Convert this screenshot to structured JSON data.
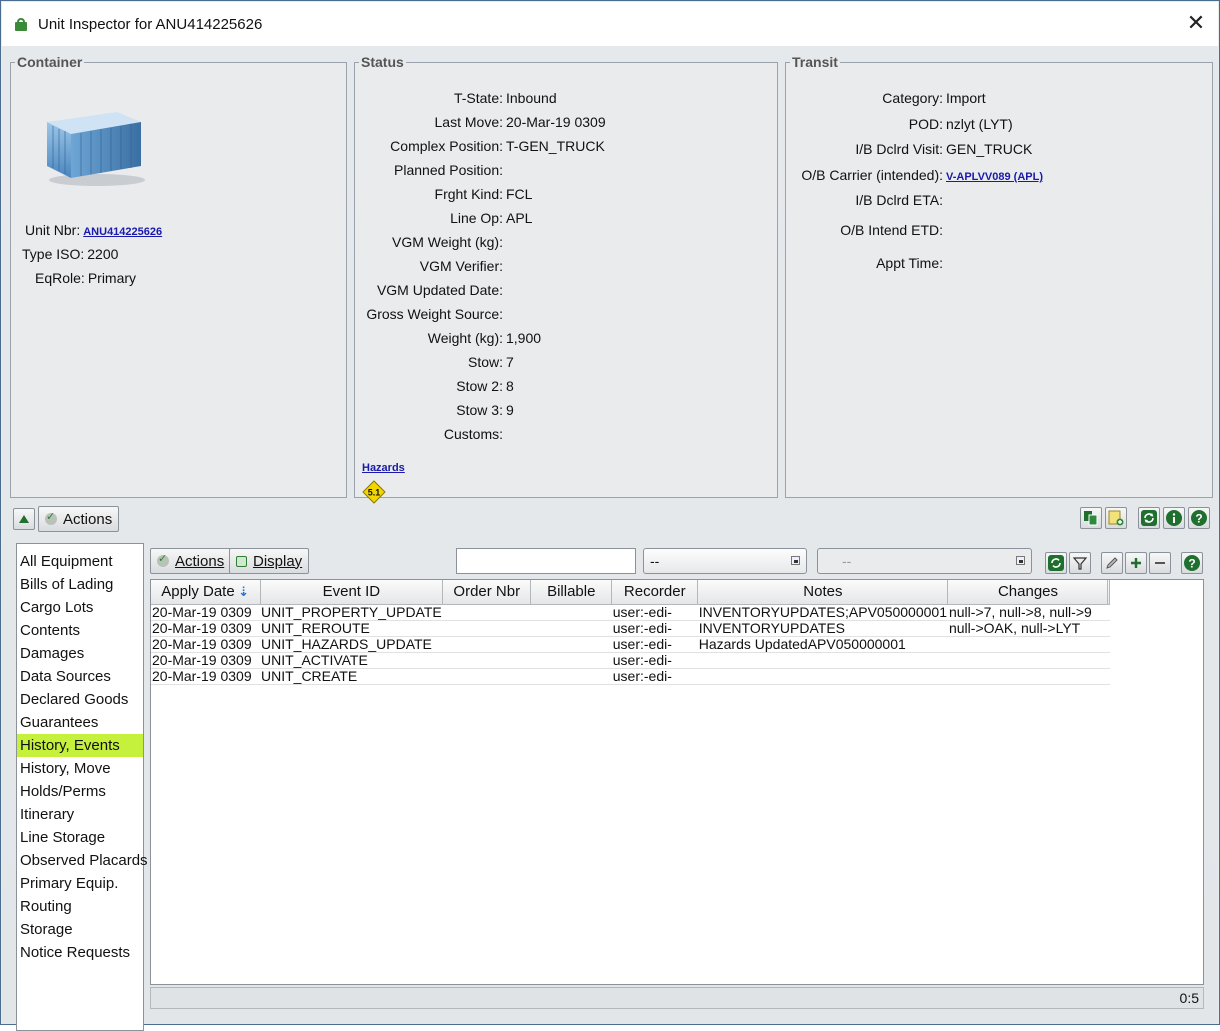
{
  "window": {
    "title": "Unit Inspector for ANU414225626",
    "close_glyph": "✕"
  },
  "container": {
    "legend": "Container",
    "image_icon": "shipping-container-icon",
    "fields": [
      {
        "label": "Unit Nbr:",
        "value": "ANU414225626",
        "is_link": true
      },
      {
        "label": "Type ISO:",
        "value": "2200"
      },
      {
        "label": "EqRole:",
        "value": "Primary"
      }
    ]
  },
  "status": {
    "legend": "Status",
    "fields": [
      {
        "label": "T-State:",
        "value": "Inbound"
      },
      {
        "label": "Last Move:",
        "value": "20-Mar-19 0309"
      },
      {
        "label": "Complex Position:",
        "value": "T-GEN_TRUCK"
      },
      {
        "label": "Planned Position:",
        "value": ""
      },
      {
        "label": "Frght Kind:",
        "value": "FCL"
      },
      {
        "label": "Line Op:",
        "value": "APL"
      },
      {
        "label": "VGM Weight (kg):",
        "value": ""
      },
      {
        "label": "VGM Verifier:",
        "value": ""
      },
      {
        "label": "VGM Updated Date:",
        "value": ""
      },
      {
        "label": "Gross Weight Source:",
        "value": ""
      },
      {
        "label": "Weight (kg):",
        "value": "1,900"
      },
      {
        "label": "Stow:",
        "value": "7"
      },
      {
        "label": "Stow 2:",
        "value": "8"
      },
      {
        "label": "Stow 3:",
        "value": "9"
      },
      {
        "label": "Customs:",
        "value": ""
      }
    ],
    "hazards_link": "Hazards",
    "hazard_class": "5.1",
    "hazard_color": "#f2d600"
  },
  "transit": {
    "legend": "Transit",
    "fields": [
      {
        "label": "Category:",
        "value": "Import"
      },
      {
        "label": "POD:",
        "value": "nzlyt (LYT)"
      },
      {
        "label": "I/B Dclrd Visit:",
        "value": "GEN_TRUCK"
      },
      {
        "label": "O/B Carrier (intended):",
        "value": "V-APLVV089 (APL)",
        "is_link": true
      },
      {
        "label": "I/B Dclrd ETA:",
        "value": ""
      },
      {
        "label": "O/B Intend ETD:",
        "value": ""
      },
      {
        "label": "Appt Time:",
        "value": ""
      }
    ]
  },
  "toolbar": {
    "collapse_icon": "triangle-up-icon",
    "actions_label": "Actions",
    "right_icons": [
      "copy-icon",
      "add-note-icon",
      "refresh-icon",
      "info-icon",
      "help-icon"
    ]
  },
  "nav": {
    "items": [
      "All Equipment",
      "Bills of Lading",
      "Cargo Lots",
      "Contents",
      "Damages",
      "Data Sources",
      "Declared Goods",
      "Guarantees",
      "History, Events",
      "History, Move",
      "Holds/Perms",
      "Itinerary",
      "Line Storage",
      "Observed Placards",
      "Primary Equip.",
      "Routing",
      "Storage",
      "Notice Requests"
    ],
    "selected": "History, Events",
    "selected_color": "#c5f03b"
  },
  "grid_toolbar": {
    "actions_label": "Actions",
    "display_label": "Display",
    "search_value": "",
    "combo1_value": "--",
    "combo2_value": "--"
  },
  "grid": {
    "columns": [
      "Apply Date",
      "Event ID",
      "Order Nbr",
      "Billable",
      "Recorder",
      "Notes",
      "Changes"
    ],
    "sort_icon": "sort-descending-icon",
    "rows": [
      [
        "20-Mar-19 0309",
        "UNIT_PROPERTY_UPDATE",
        "",
        "",
        "user:-edi-",
        "INVENTORYUPDATES;APV050000001",
        "null->7, null->8, null->9"
      ],
      [
        "20-Mar-19 0309",
        "UNIT_REROUTE",
        "",
        "",
        "user:-edi-",
        "INVENTORYUPDATES",
        "null->OAK, null->LYT"
      ],
      [
        "20-Mar-19 0309",
        "UNIT_HAZARDS_UPDATE",
        "",
        "",
        "user:-edi-",
        "Hazards UpdatedAPV050000001",
        ""
      ],
      [
        "20-Mar-19 0309",
        "UNIT_ACTIVATE",
        "",
        "",
        "user:-edi-",
        "",
        ""
      ],
      [
        "20-Mar-19 0309",
        "UNIT_CREATE",
        "",
        "",
        "user:-edi-",
        "",
        ""
      ]
    ],
    "count": "0:5"
  }
}
